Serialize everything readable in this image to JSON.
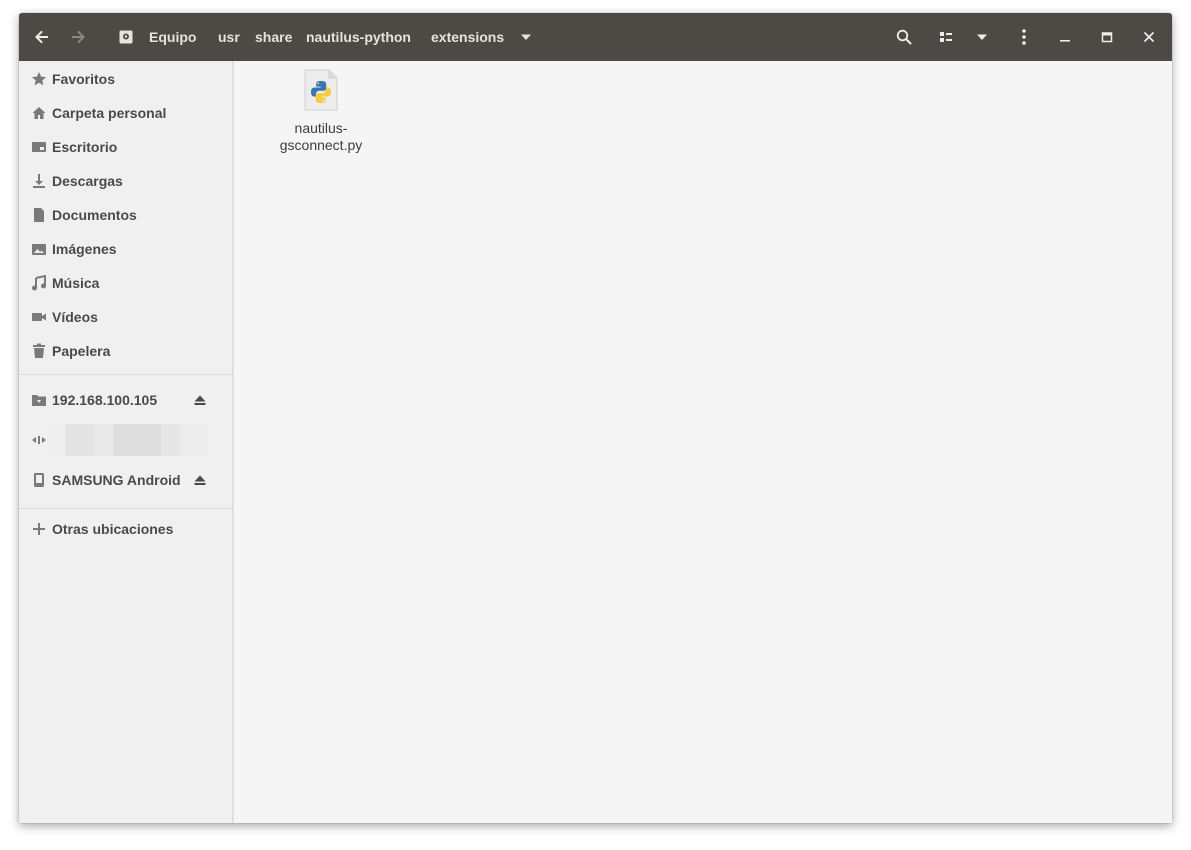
{
  "headerbar": {
    "breadcrumbs": [
      "Equipo",
      "usr",
      "share",
      "nautilus-python",
      "extensions"
    ],
    "back_icon": "arrow-left-icon",
    "forward_icon": "arrow-right-icon",
    "search_icon": "search-icon",
    "view_icon": "list-view-icon",
    "sort_icon": "chevron-down-icon",
    "menu_icon": "kebab-menu-icon"
  },
  "sidebar": {
    "places": [
      {
        "label": "Favoritos",
        "icon": "star-icon"
      },
      {
        "label": "Carpeta personal",
        "icon": "home-icon"
      },
      {
        "label": "Escritorio",
        "icon": "desktop-icon"
      },
      {
        "label": "Descargas",
        "icon": "download-icon"
      },
      {
        "label": "Documentos",
        "icon": "document-icon"
      },
      {
        "label": "Imágenes",
        "icon": "image-icon"
      },
      {
        "label": "Música",
        "icon": "music-icon"
      },
      {
        "label": "Vídeos",
        "icon": "video-icon"
      },
      {
        "label": "Papelera",
        "icon": "trash-icon"
      }
    ],
    "devices": [
      {
        "label": "192.168.100.105",
        "icon": "network-folder-icon",
        "ejectable": true
      },
      {
        "label": "SAMSUNG Android",
        "icon": "phone-icon",
        "ejectable": true
      }
    ],
    "other_locations": "Otras ubicaciones"
  },
  "files": [
    {
      "name_line1": "nautilus-",
      "name_line2": "gsconnect.py",
      "icon": "python-file-icon"
    }
  ],
  "colors": {
    "headerbar_bg": "#4d4944",
    "sidebar_bg": "#f0f0f0",
    "content_bg": "#f5f5f5"
  }
}
